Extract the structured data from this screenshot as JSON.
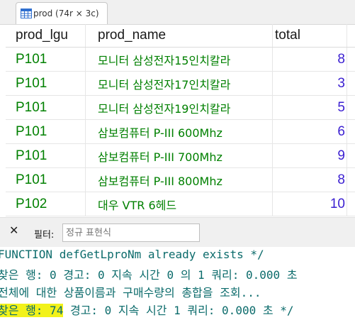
{
  "tab": {
    "label": "prod (74r × 3c)"
  },
  "grid": {
    "columns": [
      "prod_lgu",
      "prod_name",
      "total"
    ],
    "rows": [
      [
        "P101",
        "모니터 삼성전자15인치칼라",
        "8"
      ],
      [
        "P101",
        "모니터 삼성전자17인치칼라",
        "3"
      ],
      [
        "P101",
        "모니터 삼성전자19인치칼라",
        "5"
      ],
      [
        "P101",
        "삼보컴퓨터 P-III 600Mhz",
        "6"
      ],
      [
        "P101",
        "삼보컴퓨터 P-III 700Mhz",
        "9"
      ],
      [
        "P101",
        "삼보컴퓨터 P-III 800Mhz",
        "8"
      ],
      [
        "P102",
        "대우 VTR 6헤드",
        "10"
      ]
    ]
  },
  "filter": {
    "close_symbol": "✕",
    "label": "필터:",
    "placeholder": "정규 표현식"
  },
  "console": {
    "lines": [
      "FUNCTION defGetLproNm already exists */",
      "찾은 행: 0  경고: 0  지속 시간 0 의 1 쿼리: 0.000 초",
      " 전체에 대한 상품이름과 구매수량의 총합을 조회...",
      " 경고: 0  지속 시간 1 쿼리: 0.000 초 */"
    ],
    "highlight": "찾은 행: 74"
  },
  "colors": {
    "code_green": "#008000",
    "number_blue": "#3b1fd1",
    "console_teal": "#0b6b6b",
    "highlight_yellow": "#f2f21a"
  }
}
